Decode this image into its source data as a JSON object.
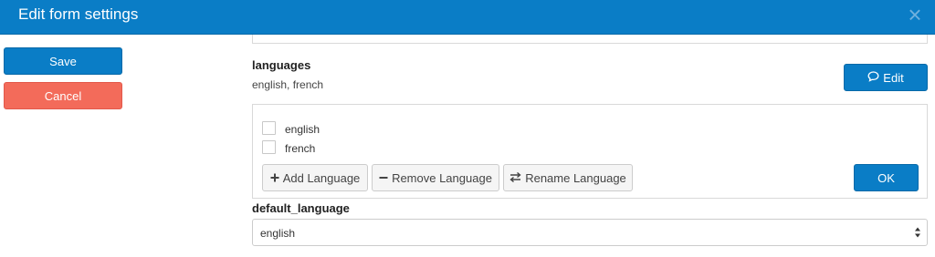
{
  "header": {
    "title": "Edit form settings",
    "close_icon": "×"
  },
  "sidebar": {
    "save_label": "Save",
    "cancel_label": "Cancel"
  },
  "languages_field": {
    "label": "languages",
    "value": "english, french",
    "edit_label": "Edit",
    "edit_icon": "comment-icon"
  },
  "languages_panel": {
    "options": [
      {
        "label": "english",
        "checked": false
      },
      {
        "label": "french",
        "checked": false
      }
    ],
    "add_label": "Add Language",
    "remove_label": "Remove Language",
    "rename_label": "Rename Language",
    "ok_label": "OK"
  },
  "default_language_field": {
    "label": "default_language",
    "selected": "english"
  },
  "colors": {
    "primary": "#0a7dc6",
    "danger": "#f36b5a"
  }
}
